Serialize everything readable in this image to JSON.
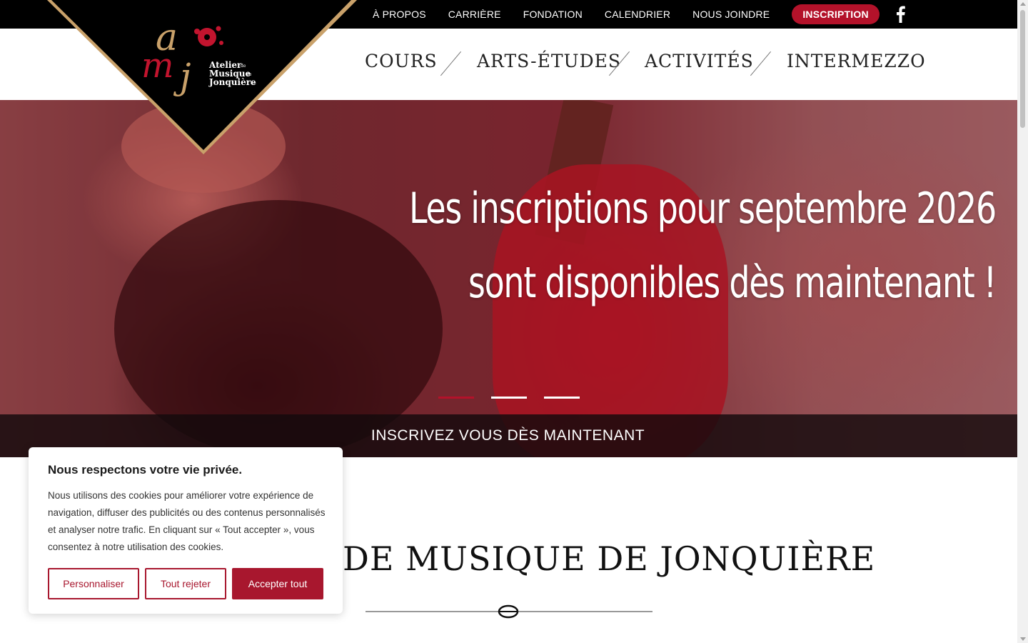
{
  "topbar": {
    "links": [
      "À PROPOS",
      "CARRIÈRE",
      "FONDATION",
      "CALENDRIER",
      "NOUS JOINDRE"
    ],
    "cta": "INSCRIPTION",
    "social_icon": "facebook-icon"
  },
  "logo": {
    "letters": "amj",
    "line1": "Atelier",
    "line1_small": "de",
    "line2": "Musique",
    "line2_small": "de",
    "line3": "Jonquière",
    "line3_small": "inc"
  },
  "mainnav": {
    "items": [
      "COURS",
      "ARTS-ÉTUDES",
      "ACTIVITÉS",
      "INTERMEZZO"
    ]
  },
  "hero": {
    "line1": "Les inscriptions pour septembre 2026",
    "line2": "sont disponibles dès maintenant !",
    "bar_text": "INSCRIVEZ VOUS DÈS MAINTENANT",
    "slides": 3,
    "active_slide": 1
  },
  "section": {
    "title": "DE MUSIQUE DE JONQUIÈRE"
  },
  "cookie": {
    "title": "Nous respectons votre vie privée.",
    "body": "Nous utilisons des cookies pour améliorer votre expérience de navigation, diffuser des publicités ou des contenus personnalisés et analyser notre trafic. En cliquant sur « Tout accepter », vous consentez à notre utilisation des cookies.",
    "customize": "Personnaliser",
    "reject": "Tout rejeter",
    "accept": "Accepter tout"
  },
  "colors": {
    "brand_red": "#b3122a",
    "topbar_bg": "#000000",
    "logo_gold": "#c9a16a"
  }
}
